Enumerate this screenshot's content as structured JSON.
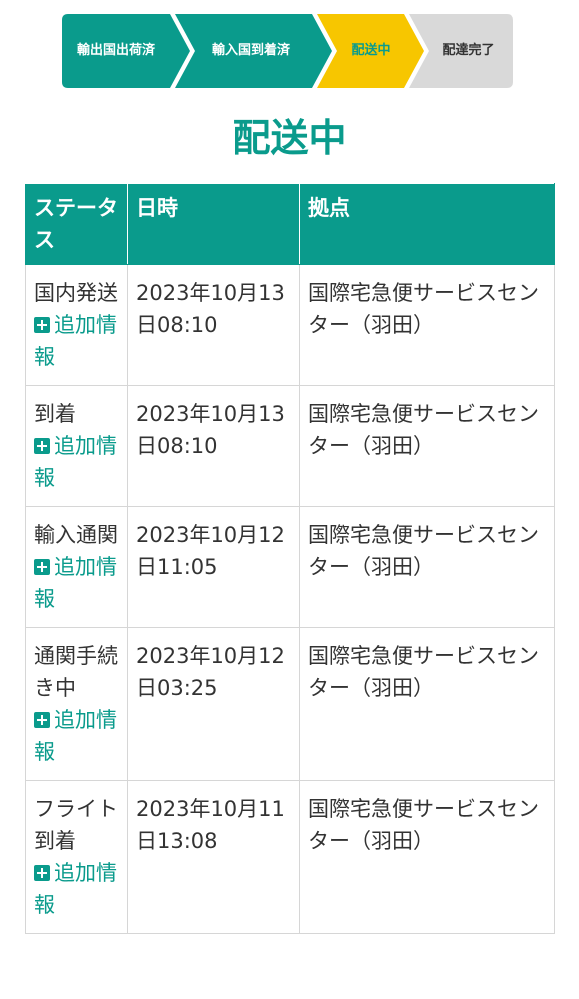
{
  "stepper": {
    "steps": [
      {
        "label": "輸出国出荷済",
        "state": "done"
      },
      {
        "label": "輸入国到着済",
        "state": "done"
      },
      {
        "label": "配送中",
        "state": "current"
      },
      {
        "label": "配達完了",
        "state": "pending"
      }
    ],
    "colors": {
      "done": "#0a9b8c",
      "current": "#f7c600",
      "pending": "#d9d9d9"
    }
  },
  "title": "配送中",
  "table": {
    "headers": [
      "ステータス",
      "日時",
      "拠点"
    ],
    "more_label": "追加情報",
    "rows": [
      {
        "status": "国内発送",
        "datetime": "2023年10月13日08:10",
        "location": "国際宅急便サービスセンター（羽田）"
      },
      {
        "status": "到着",
        "datetime": "2023年10月13日08:10",
        "location": "国際宅急便サービスセンター（羽田）"
      },
      {
        "status": "輸入通関",
        "datetime": "2023年10月12日11:05",
        "location": "国際宅急便サービスセンター（羽田）"
      },
      {
        "status": "通関手続き中",
        "datetime": "2023年10月12日03:25",
        "location": "国際宅急便サービスセンター（羽田）"
      },
      {
        "status": "フライト到着",
        "datetime": "2023年10月11日13:08",
        "location": "国際宅急便サービスセンター（羽田）"
      }
    ]
  }
}
